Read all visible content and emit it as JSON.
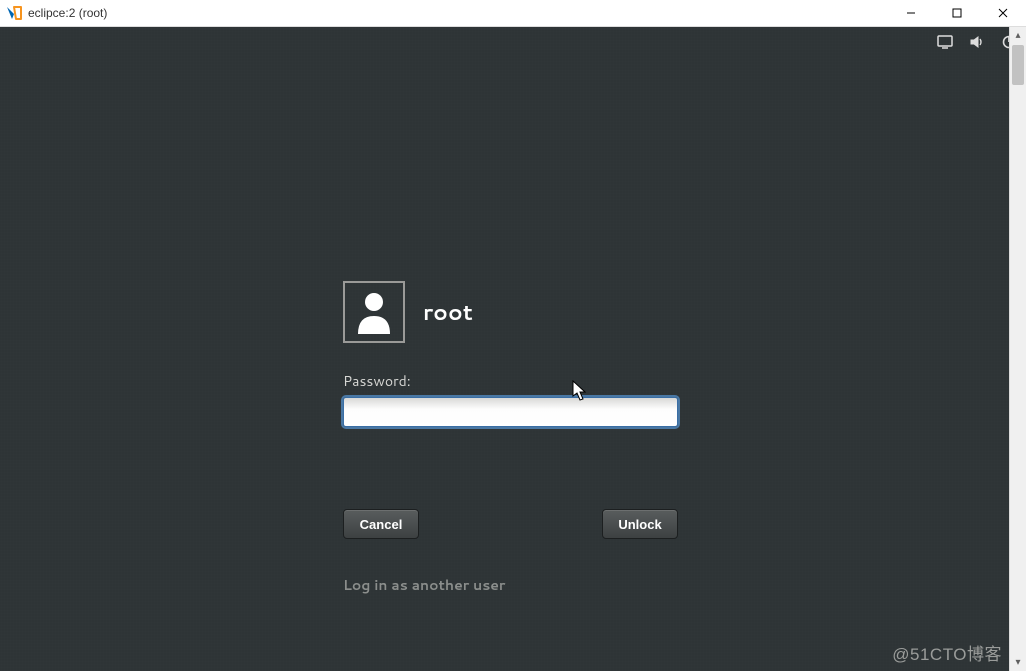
{
  "window": {
    "title": "eclipce:2 (root)"
  },
  "login": {
    "username": "root",
    "password_label": "Password:",
    "password_value": "",
    "cancel": "Cancel",
    "unlock": "Unlock",
    "other_user": "Log in as another user"
  },
  "watermark": "@51CTO博客"
}
